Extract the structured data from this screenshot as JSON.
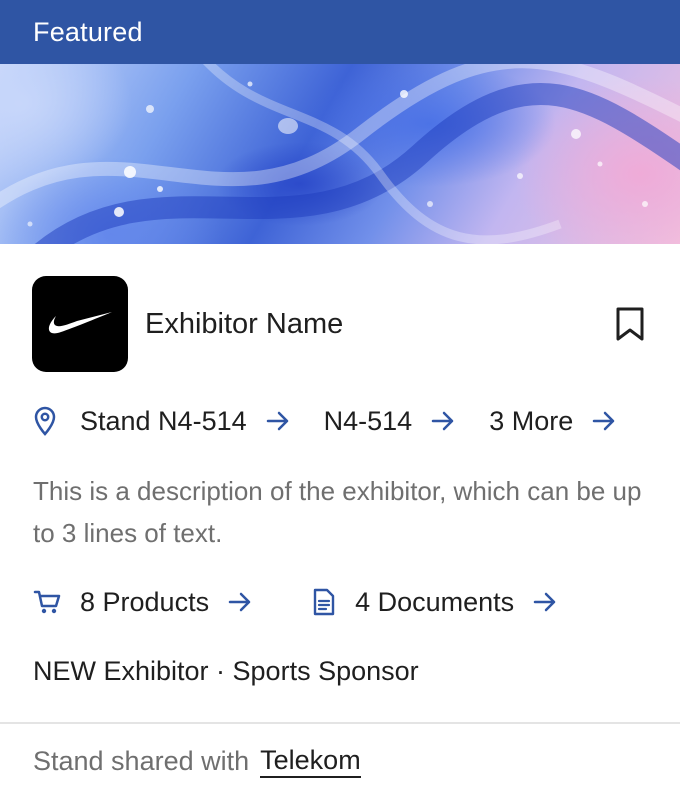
{
  "badge": {
    "label": "Featured"
  },
  "exhibitor": {
    "name": "Exhibitor Name",
    "logo_icon": "nike-swoosh-logo"
  },
  "stand": {
    "icon": "map-pin-icon",
    "links": [
      {
        "label": "Stand N4-514"
      },
      {
        "label": "N4-514"
      },
      {
        "label": "3 More"
      }
    ]
  },
  "description": "This is a description of the exhibitor, which can be up to 3 lines of text.",
  "resources": {
    "products": {
      "label": "8 Products",
      "icon": "cart-icon"
    },
    "documents": {
      "label": "4 Documents",
      "icon": "document-icon"
    }
  },
  "tags": {
    "text": "NEW Exhibitor · Sports Sponsor"
  },
  "shared": {
    "prefix": "Stand shared with",
    "partner": "Telekom"
  },
  "colors": {
    "header": "#2f55a4",
    "accent": "#2f55a4",
    "text": "#1f1f1f",
    "muted": "#6f6f6f"
  }
}
